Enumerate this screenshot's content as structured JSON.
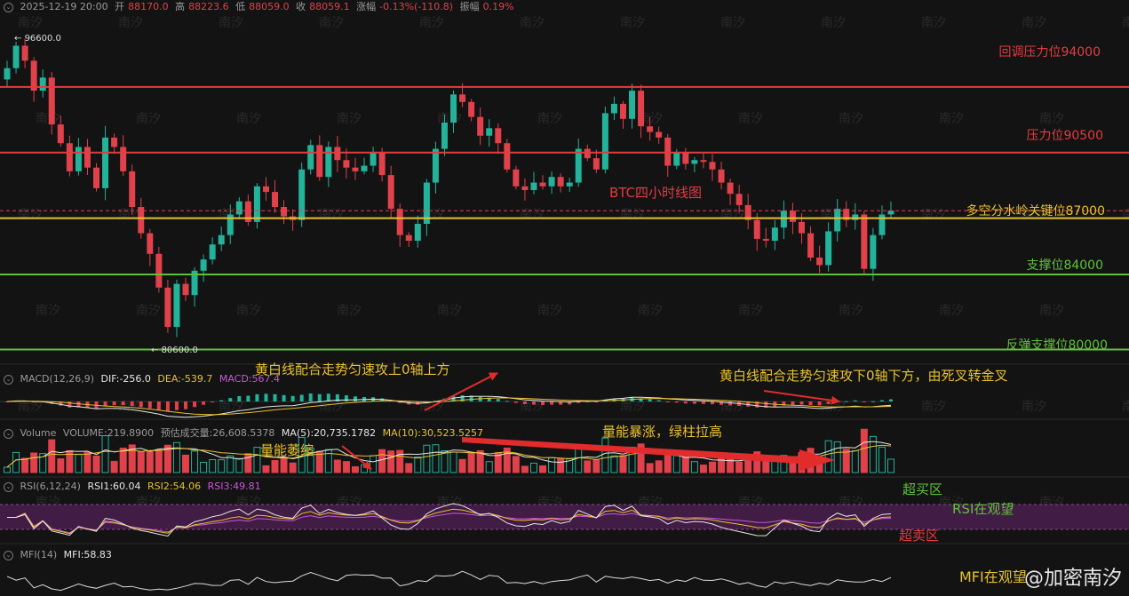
{
  "header": {
    "datetime": "2025-12-19 20:00",
    "open_label": "开",
    "open": "88170.0",
    "high_label": "高",
    "high": "88223.6",
    "low_label": "低",
    "low": "88059.0",
    "close_label": "收",
    "close": "88059.1",
    "change_label": "涨幅",
    "change": "-0.13%(-110.8)",
    "amp_label": "振幅",
    "amp": "0.19%"
  },
  "price_markers": {
    "high": "96600.0",
    "low": "80600.0"
  },
  "chart_title": "BTC四小时线图",
  "levels": [
    {
      "label": "回调压力位94000",
      "price": 94000,
      "color": "#e23b42"
    },
    {
      "label": "压力位90500",
      "price": 90500,
      "color": "#e23b42"
    },
    {
      "label": "多空分水岭关键位87000",
      "price": 87000,
      "color": "#e8c22c"
    },
    {
      "label": "支撑位84000",
      "price": 84000,
      "color": "#5fc03a"
    },
    {
      "label": "反弹支撑位80000",
      "price": 80000,
      "color": "#5fc03a"
    }
  ],
  "macd": {
    "name": "MACD(12,26,9)",
    "dif": "DIF:-256.0",
    "dea": "DEA:-539.7",
    "macd": "MACD:567.4",
    "note1": "黄白线配合走势匀速攻上0轴上方",
    "note2": "黄白线配合走势匀速攻下0轴下方，由死叉转金叉"
  },
  "volume": {
    "name": "Volume",
    "vol": "VOLUME:219.8900",
    "est": "预估成交量:26,608.5378",
    "ma5": "MA(5):20,735.1782",
    "ma10": "MA(10):30,523.5257",
    "note_shrink": "量能萎缩",
    "note_surge": "量能暴涨，绿柱拉高"
  },
  "rsi": {
    "name": "RSI(6,12,24)",
    "rsi1": "RSI1:60.04",
    "rsi2": "RSI2:54.06",
    "rsi3": "RSI3:49.81",
    "overbought": "超买区",
    "watch": "RSI在观望",
    "oversold": "超卖区"
  },
  "mfi": {
    "name": "MFI(14)",
    "value": "MFI:58.83",
    "note": "MFI在观望"
  },
  "watermark": "南汐",
  "brand": "@加密南汐",
  "colors": {
    "up": "#e0414a",
    "down": "#22b39a",
    "yellow": "#e8c22c",
    "white": "#e6e6e6",
    "purple": "#c858d8"
  },
  "chart_data": {
    "type": "candlestick",
    "title": "BTC四小时线图",
    "ylim": [
      79500,
      97500
    ],
    "series": [
      {
        "name": "BTC",
        "values": [
          95000,
          96200,
          95400,
          93800,
          94500,
          92000,
          91000,
          89500,
          90800,
          89700,
          88600,
          91300,
          90800,
          89500,
          87600,
          86200,
          85100,
          83300,
          81200,
          83500,
          82900,
          84200,
          84800,
          85600,
          86100,
          87200,
          87900,
          86800,
          88700,
          88400,
          87600,
          87100,
          86900,
          89600,
          90900,
          89200,
          90800,
          90100,
          89700,
          89500,
          89800,
          90500,
          89300,
          87500,
          86100,
          85800,
          86700,
          88900,
          90700,
          92100,
          93600,
          93200,
          92400,
          91400,
          91800,
          91000,
          89600,
          88700,
          88500,
          88900,
          88700,
          89200,
          88700,
          88900,
          90700,
          90200,
          89600,
          92600,
          93100,
          92300,
          93800,
          91900,
          91600,
          91300,
          89800,
          90500,
          89900,
          90100,
          90000,
          89600,
          88900,
          88300,
          87700,
          86900,
          85900,
          85800,
          86500,
          87400,
          86800,
          86200,
          84900,
          84500,
          86300,
          87500,
          86900,
          87200,
          84300,
          86100,
          87200,
          87400
        ]
      }
    ]
  }
}
